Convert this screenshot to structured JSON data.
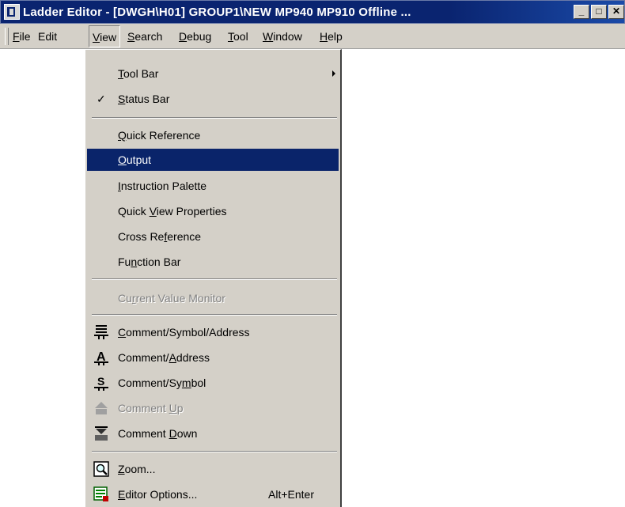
{
  "window": {
    "title": "Ladder Editor - [DWGH\\H01]    GROUP1\\NEW  MP940  MP910     Offline  ...",
    "buttons": [
      "_",
      "□",
      "✕"
    ]
  },
  "menubar": {
    "file": "ile",
    "file_m": "F",
    "edit": "Edit",
    "view": "iew",
    "view_m": "V",
    "search": "earch",
    "search_m": "S",
    "debug": "ebug",
    "debug_m": "D",
    "tool": "ool",
    "tool_m": "T",
    "window": "indow",
    "window_m": "W",
    "help": "elp",
    "help_m": "H"
  },
  "view_menu": {
    "toolbar": {
      "m": "T",
      "rest": "ool Bar"
    },
    "statusbar": {
      "m": "S",
      "rest": "tatus Bar",
      "checked": "✓"
    },
    "quickref": {
      "m": "Q",
      "rest": "uick Reference"
    },
    "output": {
      "m": "O",
      "rest": "utput"
    },
    "palette": {
      "m": "I",
      "rest": "nstruction Palette"
    },
    "qvp": {
      "pre": "Quick ",
      "m": "V",
      "rest": "iew Properties"
    },
    "crossref": {
      "pre": "Cross Re",
      "m": "f",
      "rest": "erence"
    },
    "funcbar": {
      "pre": "Fu",
      "m": "n",
      "rest": "ction Bar"
    },
    "cvm": {
      "pre": "Cu",
      "m": "r",
      "rest": "rent Value Monitor"
    },
    "csa": {
      "m": "C",
      "rest": "omment/Symbol/Address"
    },
    "ca": {
      "pre": "Comment/",
      "m": "A",
      "rest": "ddress"
    },
    "cs": {
      "pre": "Comment/Sy",
      "m": "m",
      "rest": "bol"
    },
    "cup": {
      "pre": "Comment ",
      "m": "U",
      "rest": "p"
    },
    "cdown": {
      "pre": "Comment ",
      "m": "D",
      "rest": "own"
    },
    "zoom": {
      "m": "Z",
      "rest": "oom..."
    },
    "editoropts": {
      "m": "E",
      "rest": "ditor Options...",
      "shortcut": "Alt+Enter"
    }
  }
}
